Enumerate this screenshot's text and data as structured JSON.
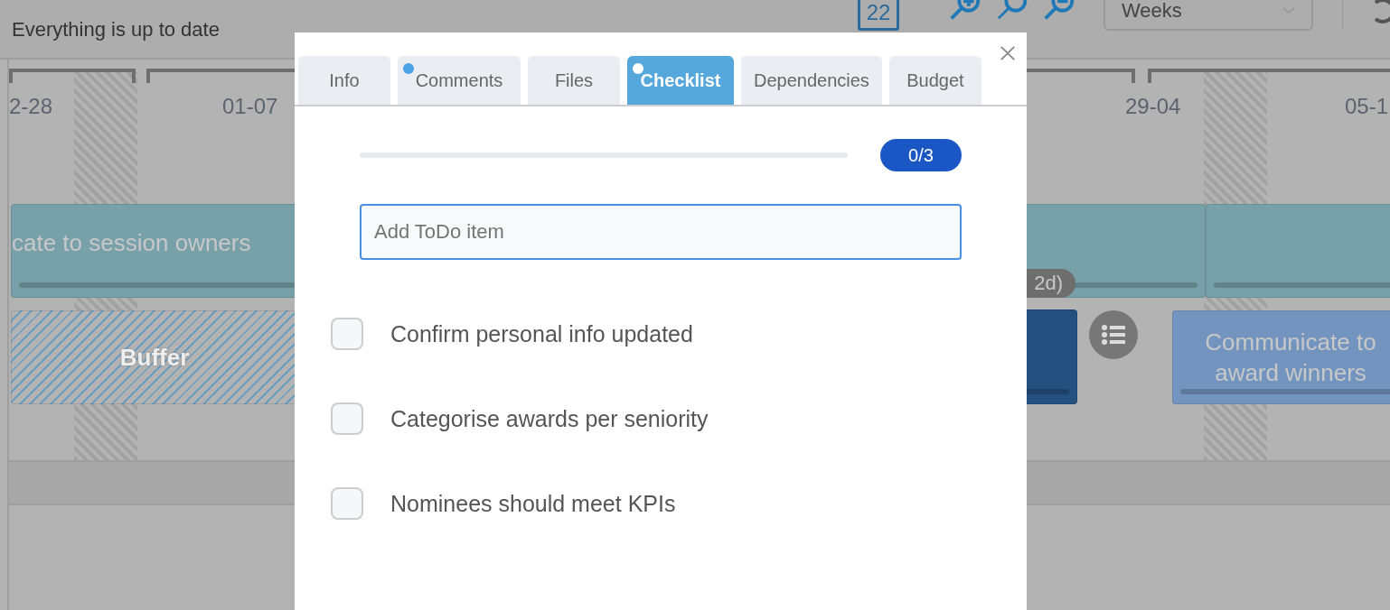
{
  "header": {
    "status": "Everything is up to date",
    "calendar_day": "22",
    "zoom_select": "Weeks"
  },
  "timeline": {
    "dates": [
      "2-28",
      "01-07",
      "29-04",
      "05-1"
    ]
  },
  "bars": [
    {
      "kind": "task",
      "label": "cate to session owners",
      "color": "#78a0a8"
    },
    {
      "kind": "task",
      "color": "#78a0a8"
    },
    {
      "kind": "duration",
      "label": "2d)"
    },
    {
      "kind": "buffer",
      "label": "Buffer"
    },
    {
      "kind": "task",
      "color": "#245080"
    },
    {
      "kind": "checklist"
    },
    {
      "kind": "task",
      "label": "Communicate to award winners",
      "color": "#7394bf"
    }
  ],
  "dialog": {
    "tabs": [
      {
        "label": "Info",
        "selected": false,
        "dot": false
      },
      {
        "label": "Comments",
        "selected": false,
        "dot": true
      },
      {
        "label": "Files",
        "selected": false,
        "dot": false
      },
      {
        "label": "Checklist",
        "selected": true,
        "dot": true
      },
      {
        "label": "Dependencies",
        "selected": false,
        "dot": false
      },
      {
        "label": "Budget",
        "selected": false,
        "dot": false
      }
    ],
    "progress": {
      "level": 0,
      "count": "0/3"
    },
    "new_item": {
      "placeholder": "Add ToDo item"
    },
    "items": [
      {
        "text": "Confirm personal info updated",
        "checked": false
      },
      {
        "text": "Categorise awards per seniority",
        "checked": false
      },
      {
        "text": "Nominees should meet KPIs",
        "checked": false
      }
    ]
  }
}
